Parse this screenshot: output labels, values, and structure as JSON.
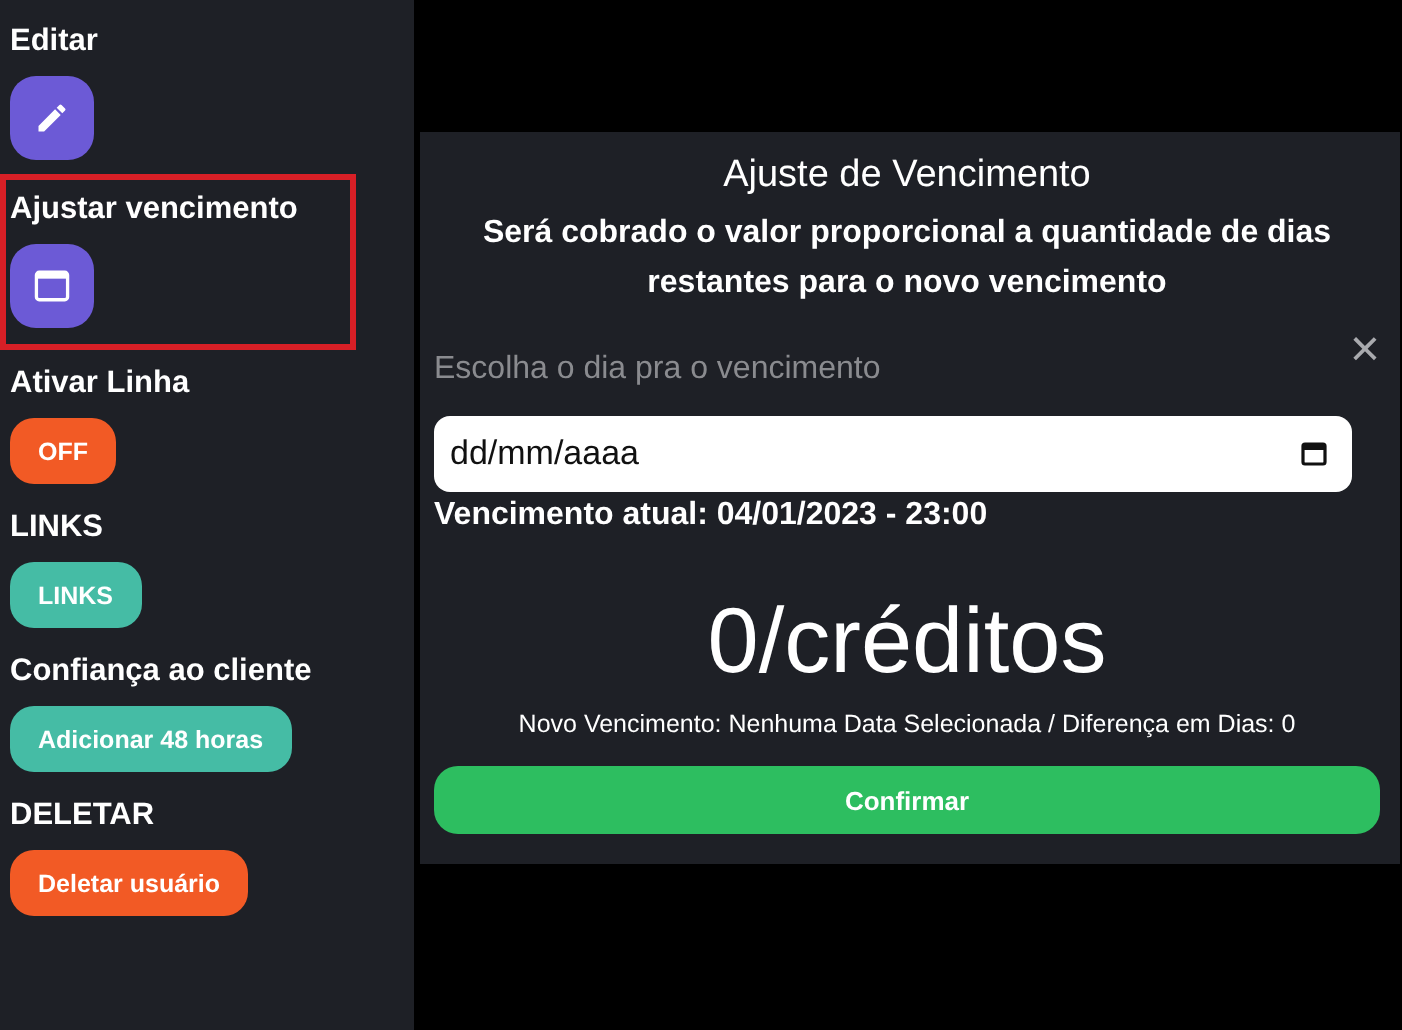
{
  "sidebar": {
    "sections": [
      {
        "title": "Editar",
        "highlighted": false,
        "button": {
          "kind": "edit",
          "color": "#6c5ad6"
        }
      },
      {
        "title": "Ajustar vencimento",
        "highlighted": true,
        "button": {
          "kind": "date",
          "color": "#6c5ad6"
        }
      },
      {
        "title": "Ativar Linha",
        "highlighted": false,
        "button": {
          "kind": "text",
          "label": "OFF",
          "color": "#f25a25"
        }
      },
      {
        "title": "LINKS",
        "highlighted": false,
        "button": {
          "kind": "text",
          "label": "LINKS",
          "color": "#45bca5"
        }
      },
      {
        "title": "Confiança ao cliente",
        "highlighted": false,
        "button": {
          "kind": "text",
          "label": "Adicionar 48 horas",
          "color": "#45bca5"
        }
      },
      {
        "title": "DELETAR",
        "highlighted": false,
        "button": {
          "kind": "text",
          "label": "Deletar usuário",
          "color": "#f25a25"
        }
      }
    ]
  },
  "modal": {
    "title": "Ajuste de Vencimento",
    "subtitle": "Será cobrado o valor proporcional a quantidade de dias restantes para o novo vencimento",
    "close": "×",
    "field_label": "Escolha o dia pra o vencimento",
    "date_field": {
      "placeholder": "dd/mm/aaaa"
    },
    "current": "Vencimento atual: 04/01/2023 - 23:00",
    "credits": "0/créditos",
    "summary": "Novo Vencimento: Nenhuma Data Selecionada / Diferença em Dias: 0",
    "confirm": "Confirmar"
  }
}
